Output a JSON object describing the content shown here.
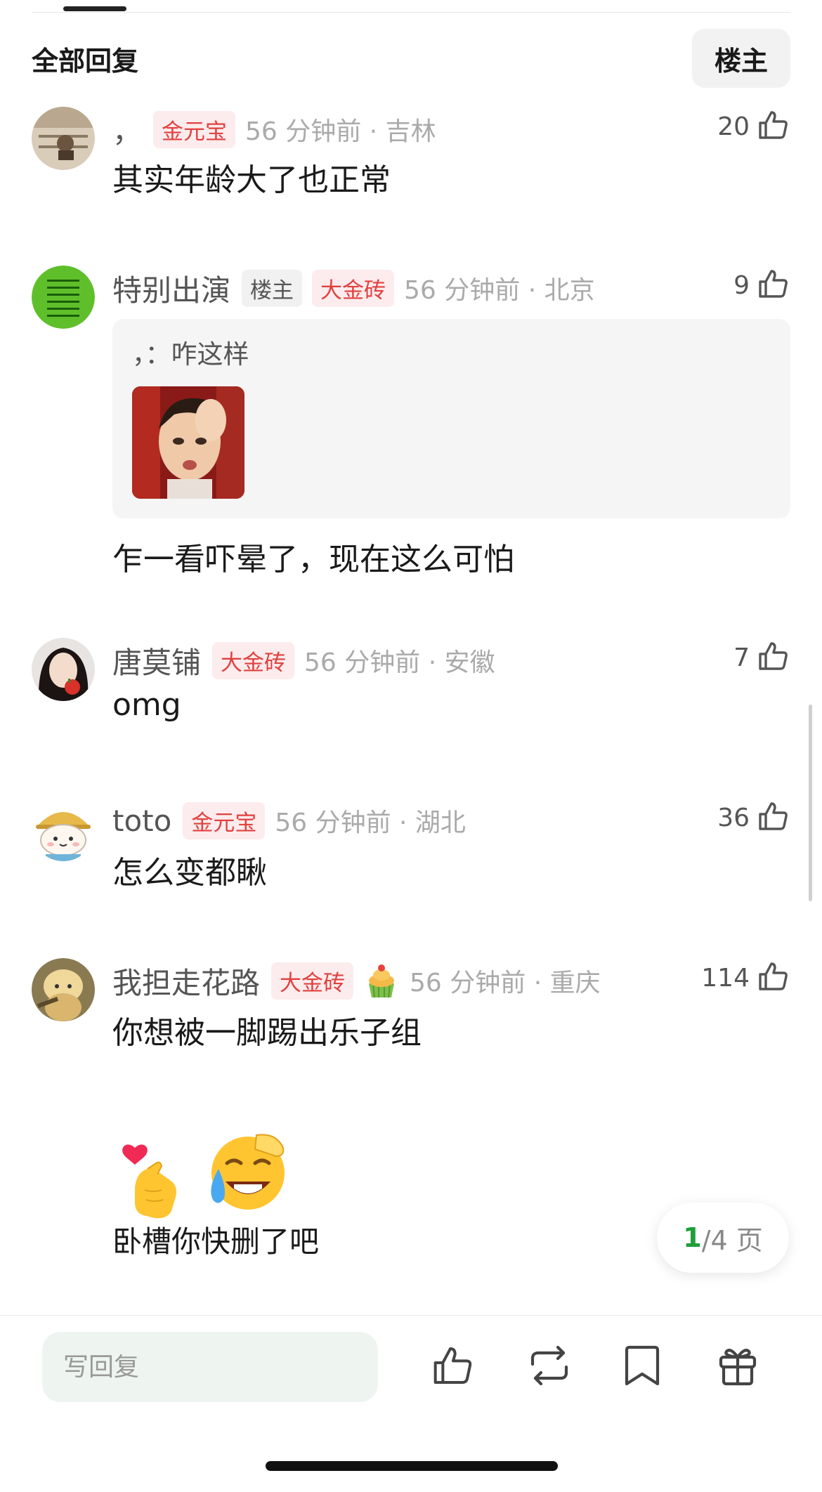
{
  "header": {
    "title": "全部回复",
    "op_filter_label": "楼主"
  },
  "comments": [
    {
      "username": "，",
      "badges": [
        "金元宝"
      ],
      "time_location": "56 分钟前 · 吉林",
      "likes": "20",
      "content": "其实年龄大了也正常"
    },
    {
      "username": "特别出演",
      "badges": [
        "楼主",
        "大金砖"
      ],
      "time_location": "56 分钟前 · 北京",
      "likes": "9",
      "quote": {
        "text": "，：咋这样"
      },
      "content": "乍一看吓晕了，现在这么可怕"
    },
    {
      "username": "唐莫铺",
      "badges": [
        "大金砖"
      ],
      "time_location": "56 分钟前 · 安徽",
      "likes": "7",
      "content": "omg"
    },
    {
      "username": "toto",
      "badges": [
        "金元宝"
      ],
      "time_location": "56 分钟前 · 湖北",
      "likes": "36",
      "content": "怎么变都瞅"
    },
    {
      "username": "我担走花路",
      "badges": [
        "大金砖"
      ],
      "time_location": "56 分钟前 · 重庆",
      "likes": "114",
      "content": "你想被一脚踢出乐子组",
      "extra_text": "卧槽你快删了吧"
    }
  ],
  "pagination": {
    "current": "1",
    "total_label": "/4 页"
  },
  "bottom_bar": {
    "reply_placeholder": "写回复"
  },
  "colors": {
    "badge_red": "#e0413f",
    "accent_green": "#1f9e3a",
    "reply_bg": "#eef5f0"
  },
  "icons": [
    "thumb-up-icon",
    "repost-icon",
    "bookmark-icon",
    "gift-icon",
    "heart-hand-emoji",
    "laughing-crying-emoji",
    "cake-icon"
  ]
}
